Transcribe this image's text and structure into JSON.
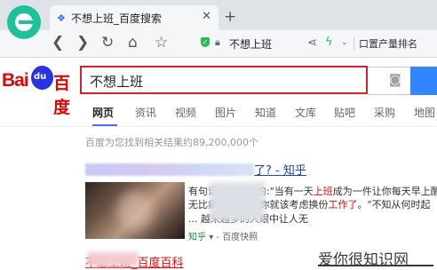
{
  "browser": {
    "tab_title": "不想上班_百度搜索",
    "tab_close": "✕",
    "new_tab": "+",
    "address": "不想上班",
    "side_search_text": "口置产量排名",
    "icons": {
      "back": "❮",
      "forward": "❯",
      "reload": "↻",
      "home": "⌂",
      "star": "☆",
      "share": "⋖",
      "bolt": "ϟ",
      "dropdown": "⌄",
      "lock": "🔒︎"
    }
  },
  "baidu": {
    "logo_bai": "Bai",
    "logo_du": "du",
    "logo_cn": "百度",
    "query": "不想上班",
    "search_tabs": [
      "网页",
      "资讯",
      "视频",
      "图片",
      "知道",
      "文库",
      "贴吧",
      "采购",
      "地图"
    ],
    "active_tab": "网页",
    "result_count": "百度为您找到相关结果约89,200,000个"
  },
  "results": [
    {
      "title_tail": "了? - 知乎",
      "snippet_lines": [
        "有句话是这么说的:\"当有一天上班成为一件让你每天早上醒",
        "无比痛苦的事情,你就该考虑换份工作了。\"不知从何时起",
        "... 越来越多的人眼中让人无"
      ],
      "source_site": "知乎",
      "source_tail": "百度快照"
    },
    {
      "title": "不想上班_百度百科"
    }
  ],
  "watermark": "爱你很知识网",
  "colors": {
    "baidu_red": "#e10602",
    "baidu_blue": "#2932e1",
    "link_blue": "#2440b3",
    "highlight_red": "#e10602"
  }
}
